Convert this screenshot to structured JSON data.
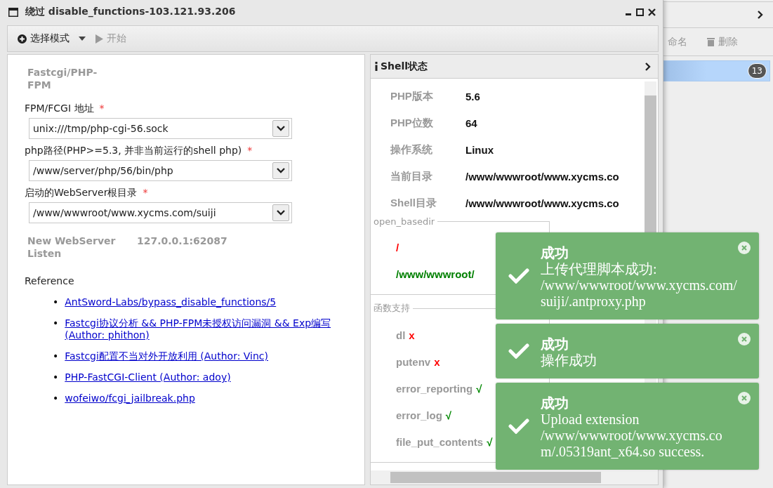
{
  "window": {
    "title": "绕过 disable_functions-103.121.93.206"
  },
  "toolbar": [
    {
      "kind": "dropdown",
      "label": "选择模式",
      "disabled": false
    },
    {
      "kind": "play",
      "label": "开始",
      "disabled": true
    }
  ],
  "form": {
    "mode": "Fastcgi/PHP-FPM",
    "required_mark": "*",
    "fields": [
      {
        "label": "FPM/FCGI 地址",
        "required": true,
        "value": "unix:///tmp/php-cgi-56.sock"
      },
      {
        "label": "php路径(PHP>=5.3, 并非当前运行的shell php)",
        "required": true,
        "value": "/www/server/php/56/bin/php"
      },
      {
        "label": "启动的WebServer根目录",
        "required": true,
        "value": "/www/wwwroot/www.xycms.com/suiji"
      }
    ],
    "listen": {
      "label": "New WebServer Listen",
      "value": "127.0.0.1:62087"
    },
    "reference": {
      "title": "Reference",
      "links": [
        {
          "bullet": "•",
          "text": "AntSword-Labs/bypass_disable_functions/5"
        },
        {
          "bullet": "•",
          "text": "Fastcgi协议分析 && PHP-FPM未授权访问漏洞 && Exp编写 (Author: phithon)"
        },
        {
          "bullet": "•",
          "text": "Fastcgi配置不当对外开放利用 (Author: Vinc)"
        },
        {
          "bullet": "•",
          "text": "PHP-FastCGI-Client (Author: adoy)"
        },
        {
          "bullet": "•",
          "text": "wofeiwo/fcgi_jailbreak.php"
        }
      ]
    }
  },
  "shell_status": {
    "title": "Shell状态",
    "rows": [
      {
        "label": "PHP版本",
        "value": "5.6"
      },
      {
        "label": "PHP位数",
        "value": "64"
      },
      {
        "label": "操作系统",
        "value": "Linux"
      },
      {
        "label": "当前目录",
        "value": "/www/wwwroot/www.xycms.co"
      },
      {
        "label": "Shell目录",
        "value": "/www/wwwroot/www.xycms.co"
      }
    ],
    "open_basedir": {
      "title": "open_basedir",
      "paths": [
        {
          "text": "/",
          "color": "#ff0000"
        },
        {
          "text": "/www/wwwroot/",
          "color": "#008000"
        }
      ]
    },
    "functions": {
      "title": "函数支持",
      "items": [
        {
          "name": "dl",
          "supported": false,
          "mark": "x"
        },
        {
          "name": "putenv",
          "supported": false,
          "mark": "x"
        },
        {
          "name": "error_reporting",
          "supported": true,
          "mark": "√"
        },
        {
          "name": "error_log",
          "supported": true,
          "mark": "√"
        },
        {
          "name": "file_put_contents",
          "supported": true,
          "mark": "√"
        }
      ]
    }
  },
  "background_window": {
    "toolbar": [
      {
        "kind": "rename",
        "label": "命名"
      },
      {
        "kind": "delete",
        "label": "删除"
      }
    ],
    "list_item": {
      "selected": true,
      "badge": "13"
    }
  },
  "toasts": [
    {
      "title": "成功",
      "lines": [
        "上传代理脚本成功:",
        "/www/wwwroot/www.xycms.com/suiji/.antproxy.php"
      ]
    },
    {
      "title": "成功",
      "lines": [
        "操作成功"
      ]
    },
    {
      "title": "成功",
      "lines": [
        "Upload extension",
        "/www/wwwroot/www.xycms.com/.05319ant_x64.so success."
      ]
    }
  ]
}
